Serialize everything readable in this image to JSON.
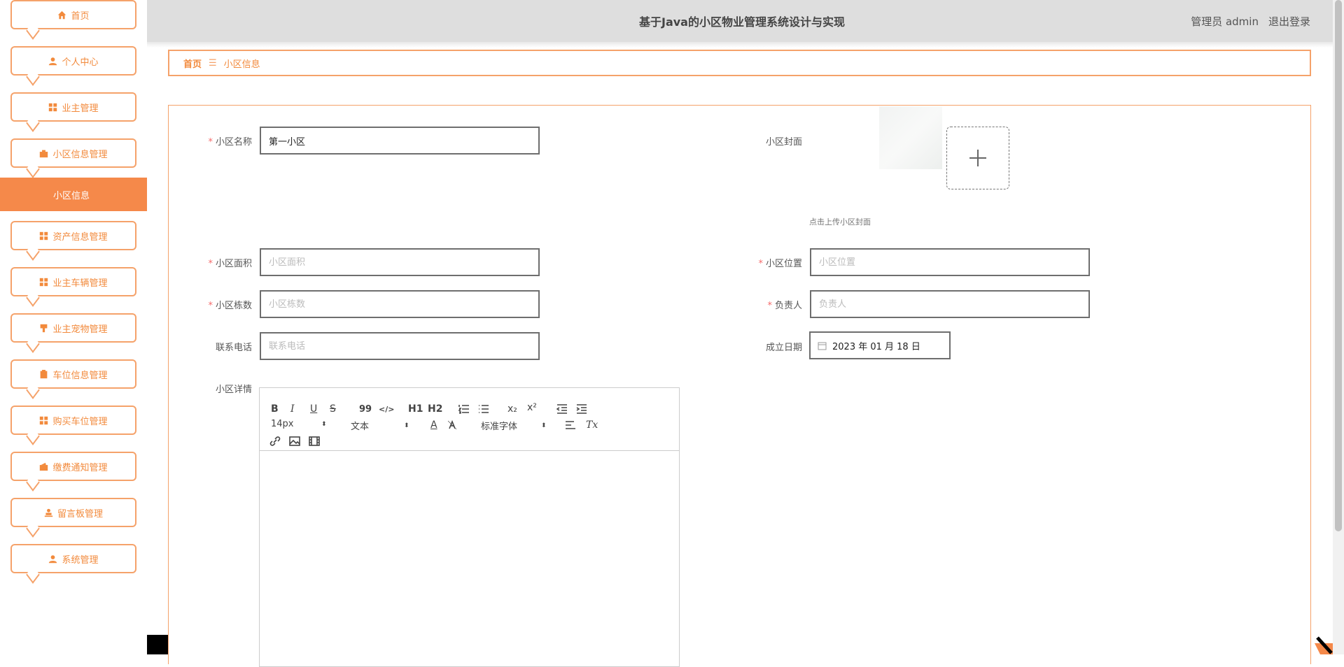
{
  "app_title": "基于Java的小区物业管理系统设计与实现",
  "user": {
    "role_name": "管理员 admin",
    "logout": "退出登录"
  },
  "sidebar": {
    "items": [
      {
        "label": "首页",
        "icon": "home-icon"
      },
      {
        "label": "个人中心",
        "icon": "user-icon"
      },
      {
        "label": "业主管理",
        "icon": "grid-icon"
      },
      {
        "label": "小区信息管理",
        "icon": "briefcase-icon"
      },
      {
        "label": "资产信息管理",
        "icon": "grid-icon"
      },
      {
        "label": "业主车辆管理",
        "icon": "grid-icon"
      },
      {
        "label": "业主宠物管理",
        "icon": "stamp-icon"
      },
      {
        "label": "车位信息管理",
        "icon": "parking-icon"
      },
      {
        "label": "购买车位管理",
        "icon": "grid-icon"
      },
      {
        "label": "缴费通知管理",
        "icon": "wallet-icon"
      },
      {
        "label": "留言板管理",
        "icon": "person-desk-icon"
      },
      {
        "label": "系统管理",
        "icon": "user-icon"
      }
    ],
    "active_sub": "小区信息"
  },
  "breadcrumb": {
    "home": "首页",
    "sep": "☰",
    "current": "小区信息"
  },
  "form": {
    "name_label": "小区名称",
    "name_value": "第一小区",
    "cover_label": "小区封面",
    "cover_hint": "点击上传小区封面",
    "area_label": "小区面积",
    "area_placeholder": "小区面积",
    "location_label": "小区位置",
    "location_placeholder": "小区位置",
    "buildings_label": "小区栋数",
    "buildings_placeholder": "小区栋数",
    "manager_label": "负责人",
    "manager_placeholder": "负责人",
    "phone_label": "联系电话",
    "phone_placeholder": "联系电话",
    "date_label": "成立日期",
    "date_value": "2023 年 01 月 18 日",
    "detail_label": "小区详情",
    "required_mark": "*"
  },
  "editor": {
    "font_size": "14px",
    "header_select": "文本",
    "font_family": "标准字体",
    "bold": "B",
    "italic": "I",
    "underline": "U",
    "strike": "S",
    "blockquote": "99",
    "code": "</>",
    "h1": "H1",
    "h2": "H2",
    "subscript": "x₂",
    "superscript": "x²",
    "color_btn": "A",
    "clean": "Tx"
  },
  "colors": {
    "accent": "#f28a3c",
    "accent_border": "#f5a26a",
    "active_bg": "#f5894a",
    "topbar_bg": "#dedede"
  }
}
